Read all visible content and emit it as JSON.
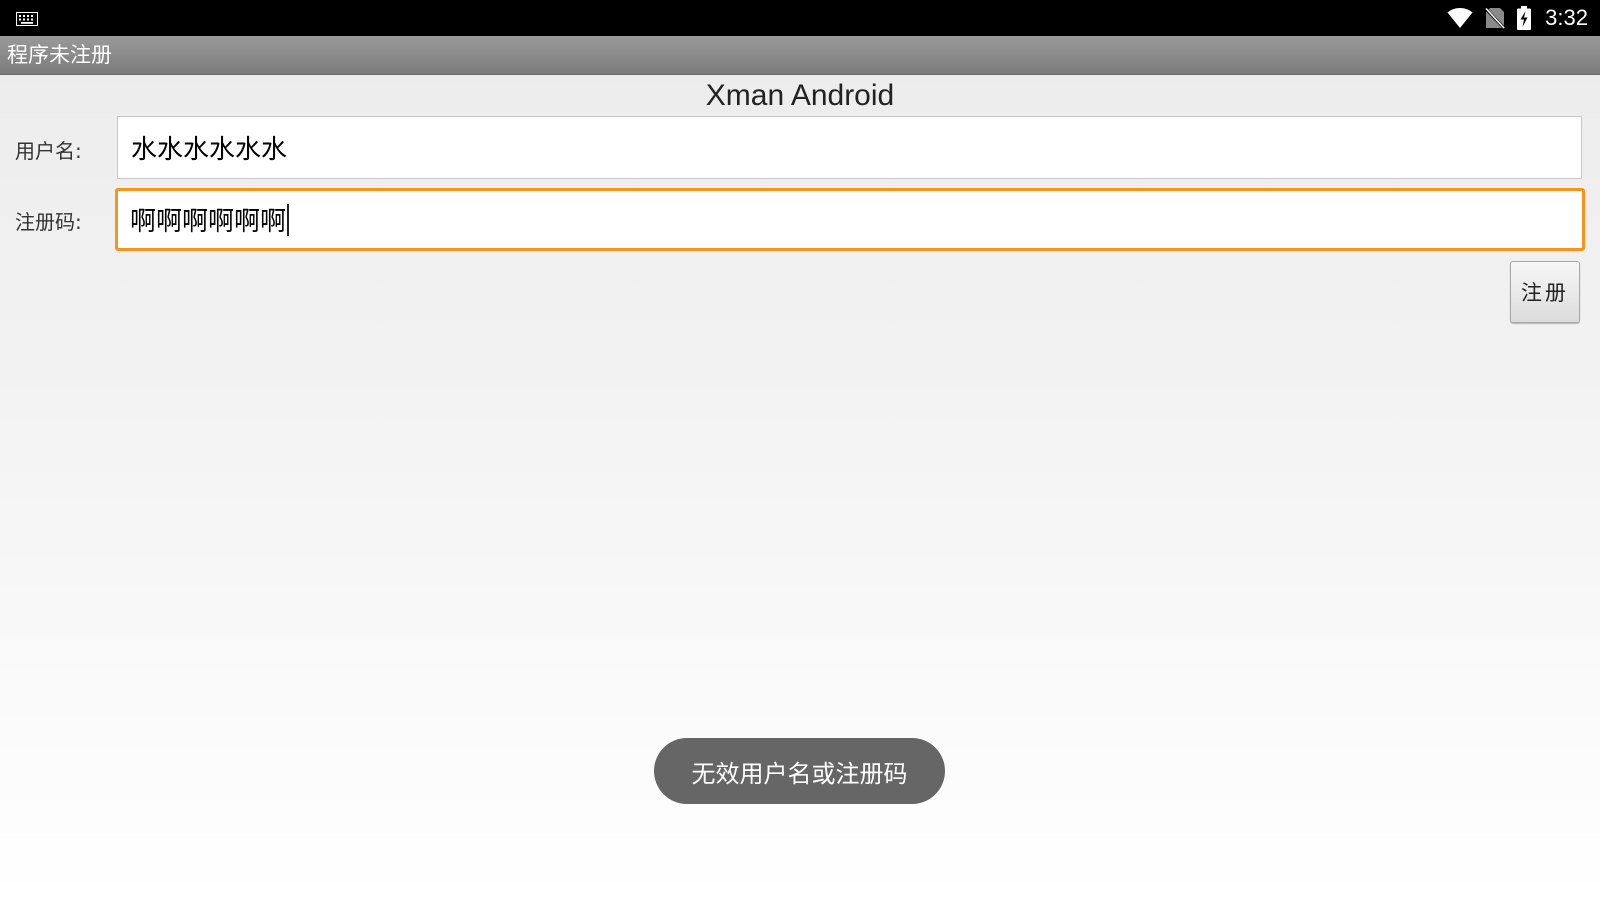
{
  "status_bar": {
    "time": "3:32",
    "icons": [
      "keyboard-icon",
      "wifi-icon",
      "no-sim-icon",
      "battery-charging-icon"
    ]
  },
  "title_bar": {
    "title": "程序未注册"
  },
  "heading": "Xman Android",
  "form": {
    "username_label": "用户名:",
    "username_value": "水水水水水水",
    "regcode_label": "注册码:",
    "regcode_value": "啊啊啊啊啊啊"
  },
  "register_button": {
    "label": "注册"
  },
  "toast": {
    "message": "无效用户名或注册码"
  },
  "colors": {
    "focus_border": "#f7941d",
    "status_bar": "#000000",
    "title_bar": "#8a8a8a",
    "toast_bg": "#666666"
  }
}
